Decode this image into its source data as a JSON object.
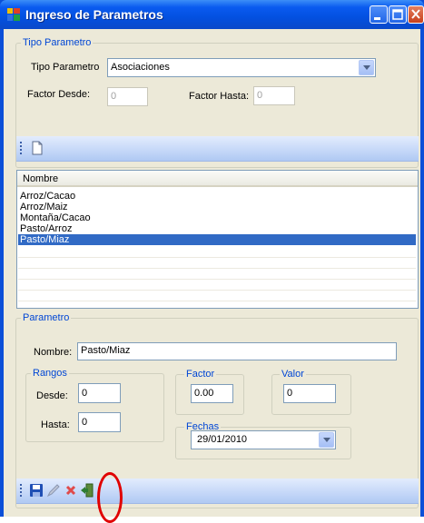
{
  "window": {
    "title": "Ingreso de Parametros"
  },
  "tipo_group": {
    "legend": "Tipo Parametro",
    "tipo_label": "Tipo Parametro",
    "tipo_value": "Asociaciones",
    "factor_desde_label": "Factor Desde:",
    "factor_desde_value": "0",
    "factor_hasta_label": "Factor Hasta:",
    "factor_hasta_value": "0"
  },
  "list": {
    "column_header": "Nombre",
    "items": [
      "Arroz/Cacao",
      "Arroz/Maiz",
      "Montaña/Cacao",
      "Pasto/Arroz",
      "Pasto/Miaz"
    ],
    "selected_index": 4
  },
  "param_group": {
    "legend": "Parametro",
    "nombre_label": "Nombre:",
    "nombre_value": "Pasto/Miaz",
    "rangos_legend": "Rangos",
    "desde_label": "Desde:",
    "desde_value": "0",
    "hasta_label": "Hasta:",
    "hasta_value": "0",
    "factor_legend": "Factor",
    "factor_value": "0.00",
    "valor_legend": "Valor",
    "valor_value": "0",
    "fechas_legend": "Fechas",
    "fechas_value": "29/01/2010"
  },
  "colors": {
    "title_bar": "#0350e0",
    "selection": "#316ac5",
    "group_legend": "#0046d5",
    "annotation": "#e00000"
  },
  "icons": [
    "app-icon",
    "new-document-icon",
    "save-icon",
    "edit-pencil-icon",
    "delete-x-icon",
    "exit-door-icon",
    "minimize-icon",
    "maximize-icon",
    "close-icon",
    "dropdown-arrow-icon"
  ]
}
